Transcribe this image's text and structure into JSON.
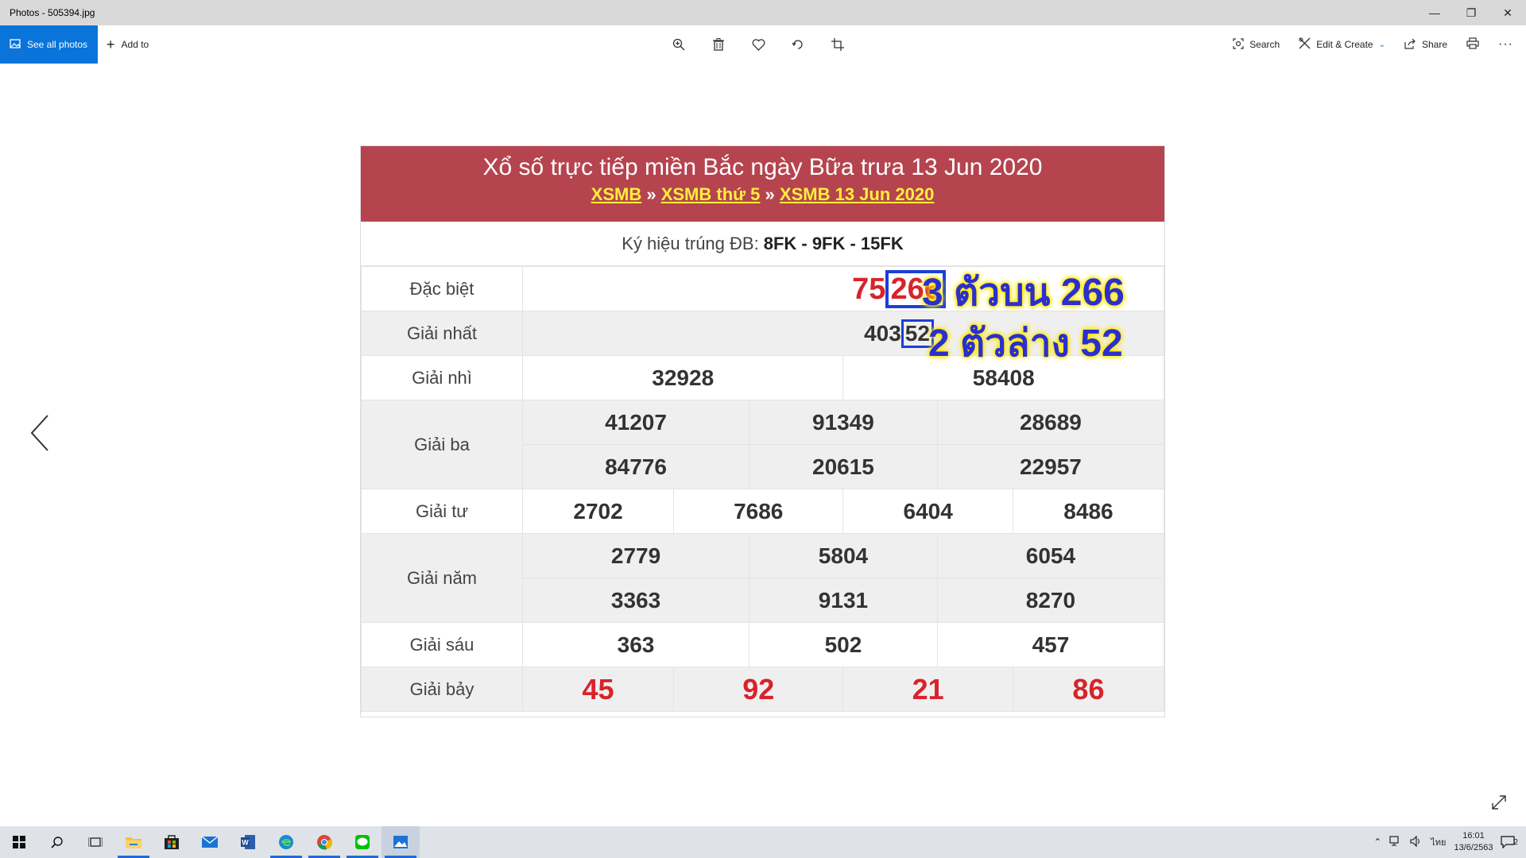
{
  "window": {
    "title": "Photos - 505394.jpg"
  },
  "toolbar": {
    "see_all_photos": "See all photos",
    "add_to": "Add to",
    "search": "Search",
    "edit_create": "Edit & Create",
    "share": "Share"
  },
  "photo": {
    "header_title": "Xổ số trực tiếp miền Bắc ngày Bữa trưa 13 Jun 2020",
    "breadcrumbs": [
      "XSMB",
      "XSMB thứ 5",
      "XSMB 13 Jun 2020"
    ],
    "crumb_sep": "»",
    "symbol_label": "Ký hiệu trúng ĐB:",
    "symbol_value": "8FK - 9FK - 15FK",
    "prizes": {
      "dac_biet": {
        "label": "Đặc biệt",
        "prefix": "75",
        "boxed": "266"
      },
      "nhat": {
        "label": "Giải nhất",
        "prefix": "403",
        "boxed": "52"
      },
      "nhi": {
        "label": "Giải nhì",
        "values": [
          "32928",
          "58408"
        ]
      },
      "ba": {
        "label": "Giải ba",
        "values": [
          "41207",
          "91349",
          "28689",
          "84776",
          "20615",
          "22957"
        ]
      },
      "tu": {
        "label": "Giải tư",
        "values": [
          "2702",
          "7686",
          "6404",
          "8486"
        ]
      },
      "nam": {
        "label": "Giải năm",
        "values": [
          "2779",
          "5804",
          "6054",
          "3363",
          "9131",
          "8270"
        ]
      },
      "sau": {
        "label": "Giải sáu",
        "values": [
          "363",
          "502",
          "457"
        ]
      },
      "bay": {
        "label": "Giải bảy",
        "values": [
          "45",
          "92",
          "21",
          "86"
        ]
      }
    },
    "overlay_top": "3 ตัวบน 266",
    "overlay_bottom": "2 ตัวล่าง 52"
  },
  "taskbar": {
    "lang": "ไทย",
    "time": "16:01",
    "date": "13/6/2563",
    "notif_count": "2"
  }
}
